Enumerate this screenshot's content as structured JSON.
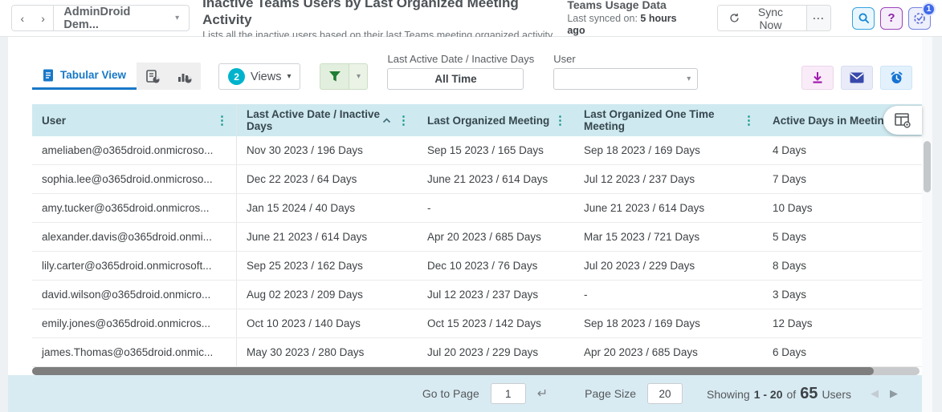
{
  "header": {
    "tenant": "AdminDroid Dem...",
    "title": "Inactive Teams Users by Last Organized Meeting Activity",
    "subtitle": "Lists all the inactive users based on their last Teams meeting organized activity.",
    "sync": {
      "source": "Teams Usage Data",
      "last_synced_label": "Last synced on:",
      "last_synced_value": "5 hours ago",
      "sync_button_label": "Sync Now"
    },
    "help_glyph": "?",
    "pending_tasks_badge": "1"
  },
  "toolbar": {
    "tab_tabular_label": "Tabular View",
    "views_count": "2",
    "views_label": "Views",
    "filters": [
      {
        "label": "Last Active Date / Inactive Days",
        "value": "All Time"
      },
      {
        "label": "User",
        "value": ""
      }
    ]
  },
  "icons": {
    "back": "chevron-left",
    "forward": "chevron-right",
    "tenant-caret": "chevron-down",
    "sync": "refresh-circular-arrow",
    "more": "ellipsis",
    "search": "magnifier",
    "help": "question-mark",
    "tasks": "clock-check",
    "tabular": "document-lines",
    "report-view": "document-pie",
    "chart-view": "bar-pie",
    "views-caret": "chevron-down",
    "filter": "funnel",
    "filter-caret": "chevron-down",
    "download": "arrow-down-tray",
    "email": "envelope",
    "alert": "alarm-clock",
    "column-settings": "table-gear",
    "sort": "chevron-up",
    "column-menu": "vertical-dots",
    "go": "return-arrow",
    "prev": "triangle-left",
    "next": "triangle-right"
  },
  "table": {
    "columns": [
      {
        "id": "user",
        "label": "User",
        "sorted": false
      },
      {
        "id": "last-active-date",
        "label": "Last Active Date / Inactive Days",
        "sorted": true
      },
      {
        "id": "last-organized-meeting",
        "label": "Last Organized Meeting",
        "sorted": false
      },
      {
        "id": "last-organized-one-time-meeting",
        "label": "Last Organized One Time Meeting",
        "sorted": false
      },
      {
        "id": "active-days-in-meeting",
        "label": "Active Days in Meeting (",
        "sorted": false
      }
    ],
    "rows": [
      [
        "ameliaben@o365droid.onmicroso...",
        "Nov 30 2023 / 196 Days",
        "Sep 15 2023 / 165 Days",
        "Sep 18 2023 / 169 Days",
        "4 Days"
      ],
      [
        "sophia.lee@o365droid.onmicroso...",
        "Dec 22 2023 / 64 Days",
        "June 21 2023 / 614 Days",
        "Jul 12 2023 / 237 Days",
        "7 Days"
      ],
      [
        "amy.tucker@o365droid.onmicros...",
        "Jan 15 2024 / 40 Days",
        "-",
        "June 21 2023 / 614 Days",
        "10 Days"
      ],
      [
        "alexander.davis@o365droid.onmi...",
        "June 21 2023 / 614 Days",
        "Apr 20 2023 / 685 Days",
        "Mar 15 2023 / 721 Days",
        "5 Days"
      ],
      [
        "lily.carter@o365droid.onmicrosoft...",
        "Sep 25 2023 / 162 Days",
        "Dec 10 2023 / 76 Days",
        "Jul 20 2023 / 229 Days",
        "8 Days"
      ],
      [
        "david.wilson@o365droid.onmicro...",
        "Aug 02 2023 / 209 Days",
        "Jul 12 2023 / 237 Days",
        "-",
        "3 Days"
      ],
      [
        "emily.jones@o365droid.onmicros...",
        "Oct 10 2023 / 140 Days",
        "Oct 15 2023 / 142 Days",
        "Sep 18 2023 / 169 Days",
        "12 Days"
      ],
      [
        "james.Thomas@o365droid.onmic...",
        "May 30 2023 / 280 Days",
        "Jul 20 2023 / 229 Days",
        "Apr 20 2023 / 685 Days",
        "6 Days"
      ]
    ]
  },
  "pagination": {
    "go_to_page_label": "Go to Page",
    "page_value": "1",
    "page_size_label": "Page Size",
    "page_size_value": "20",
    "showing_label": "Showing",
    "range": "1 - 20",
    "of_label": "of",
    "total": "65",
    "unit": "Users"
  },
  "colors": {
    "accent_blue": "#1878c8",
    "table_header_bg": "#cfe9f0",
    "teal_menu_dots": "#0e9688",
    "views_badge": "#00b3cc",
    "filter_green": "#1e7e34",
    "download_purple": "#a21caf",
    "mail_indigo": "#3949ab",
    "alert_blue": "#1673d2",
    "footer_bg": "#d9ebf2",
    "badge_blue": "#3f6ae8"
  }
}
